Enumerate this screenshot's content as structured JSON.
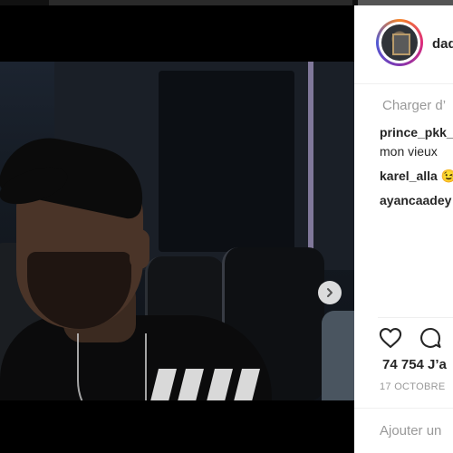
{
  "post": {
    "image_icon": "photo-of-man-in-cap",
    "carousel": {
      "dots": 3,
      "active_index": 0,
      "next_icon": "chevron-right-icon"
    }
  },
  "panel": {
    "username": "dad",
    "load_more": "Charger d’",
    "comments": [
      {
        "author": "prince_pkk_",
        "text": "mon vieux"
      },
      {
        "author": "karel_alla",
        "text": "😉"
      },
      {
        "author": "ayancaadey",
        "text": ""
      }
    ],
    "likes": "74 754 J’a",
    "date": "17 OCTOBRE",
    "add_comment_placeholder": "Ajouter un"
  },
  "colors": {
    "background": "#000000",
    "panel": "#ffffff",
    "text": "#262626",
    "muted": "#999999"
  }
}
